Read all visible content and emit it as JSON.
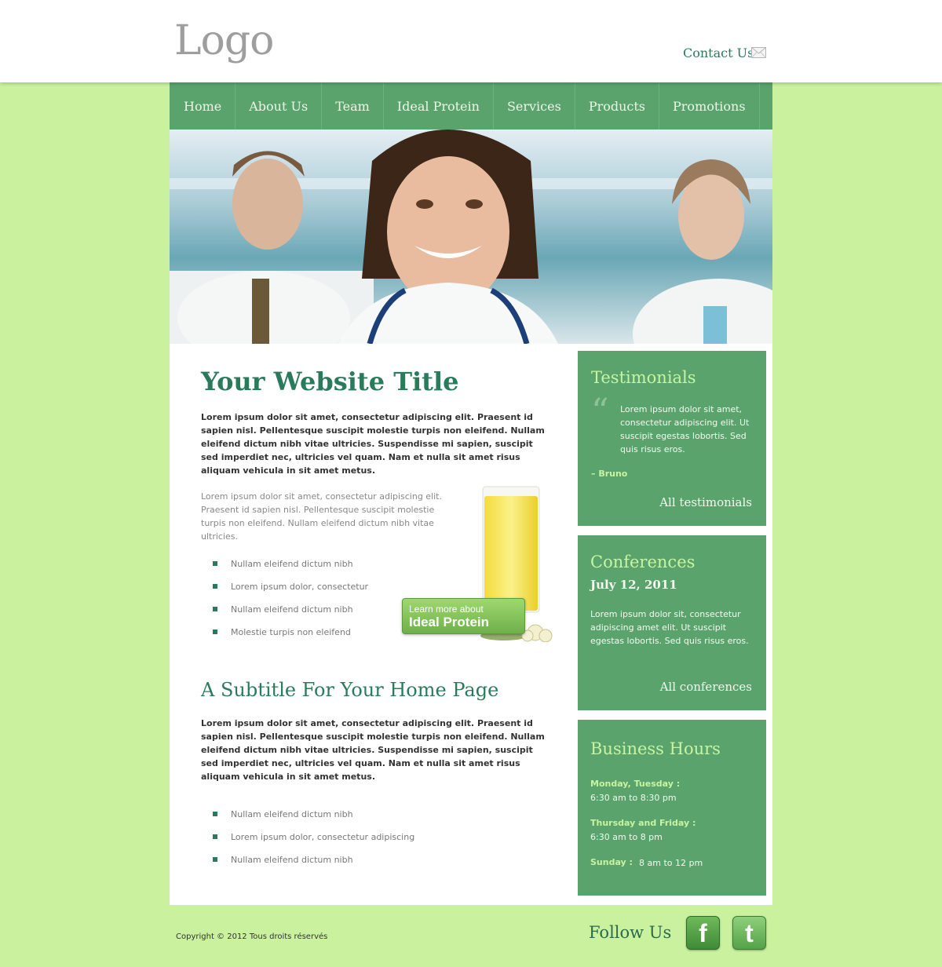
{
  "header": {
    "logo": "Logo",
    "contact_label": "Contact Us",
    "contact_icon": "mail-icon"
  },
  "nav": {
    "items": [
      {
        "label": "Home"
      },
      {
        "label": "About Us"
      },
      {
        "label": "Team"
      },
      {
        "label": "Ideal Protein"
      },
      {
        "label": "Services"
      },
      {
        "label": "Products"
      },
      {
        "label": "Promotions"
      }
    ]
  },
  "main": {
    "title": "Your Website Title",
    "intro": "Lorem ipsum dolor sit amet, consectetur adipiscing elit. Praesent id sapien nisl. Pellentesque suscipit molestie turpis non eleifend. Nullam eleifend dictum nibh vitae ultricies. Suspendisse mi sapien, suscipit sed imperdiet nec, ultricies vel quam. Nam et nulla sit amet risus aliquam vehicula in sit amet metus.",
    "paragraph": "Lorem ipsum dolor sit amet, consectetur adipiscing elit. Praesent id sapien nisl. Pellentesque suscipit molestie turpis non eleifend. Nullam eleifend dictum nibh vitae ultricies.",
    "list1": [
      "Nullam eleifend dictum nibh",
      "Lorem ipsum dolor, consectetur",
      "Nullam eleifend dictum nibh",
      "Molestie turpis non eleifend"
    ],
    "promo": {
      "line1": "Learn more about",
      "line2": "Ideal Protein"
    },
    "subtitle": "A Subtitle For Your Home Page",
    "intro2": "Lorem ipsum dolor sit amet, consectetur adipiscing elit. Praesent id sapien nisl. Pellentesque suscipit molestie turpis non eleifend. Nullam eleifend dictum nibh vitae ultricies. Suspendisse mi sapien, suscipit sed imperdiet nec, ultricies vel quam. Nam et nulla sit amet risus aliquam vehicula in sit amet metus.",
    "list2": [
      "Nullam eleifend dictum nibh",
      "Lorem ipsum dolor, consectetur adipiscing",
      "Nullam eleifend dictum nibh"
    ]
  },
  "sidebar": {
    "testimonials": {
      "heading": "Testimonials",
      "quote": "Lorem ipsum dolor sit amet, consectetur adipiscing elit. Ut suscipit egestas lobortis. Sed quis risus eros.",
      "author": "– Bruno",
      "link": "All testimonials"
    },
    "conferences": {
      "heading": "Conferences",
      "date": "July 12, 2011",
      "text": "Lorem ipsum dolor sit, consectetur adipiscing amet elit. Ut suscipit egestas lobortis. Sed quis risus eros.",
      "link": "All conferences"
    },
    "hours": {
      "heading": "Business Hours",
      "rows": [
        {
          "label": "Monday, Tuesday :",
          "value": "6:30 am to 8:30 pm"
        },
        {
          "label": "Thursday and Friday :",
          "value": "6:30 am to 8 pm"
        },
        {
          "label": "Sunday :",
          "value": "8 am to 12 pm"
        }
      ]
    }
  },
  "footer": {
    "copyright": "Copyright © 2012 Tous droits réservés",
    "follow": "Follow Us",
    "social": [
      {
        "icon": "facebook-icon",
        "glyph": "f"
      },
      {
        "icon": "twitter-icon",
        "glyph": "t"
      }
    ]
  },
  "colors": {
    "page_background": "#c9f19e",
    "nav_green": "#5aa36d",
    "title_green": "#2a7b5c",
    "sidebar_heading": "#c6f4a2"
  }
}
